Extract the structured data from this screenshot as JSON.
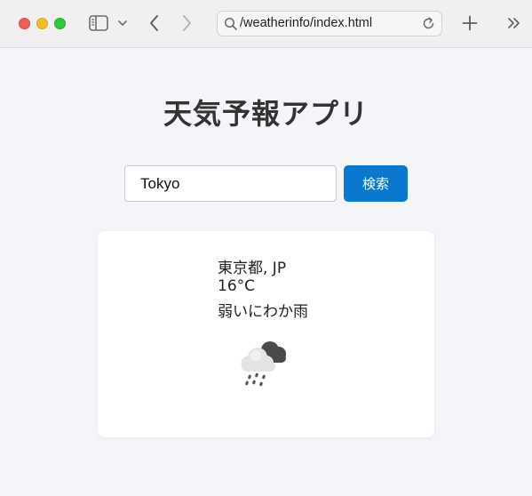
{
  "browser": {
    "url": "/weatherinfo/index.html"
  },
  "page": {
    "title": "天気予報アプリ"
  },
  "search": {
    "value": "Tokyo",
    "button_label": "検索"
  },
  "weather": {
    "location": "東京都, JP",
    "temperature": "16°C",
    "description": "弱いにわか雨",
    "icon": "cloud-rain-icon"
  },
  "colors": {
    "accent": "#0a78d1",
    "background": "#f3f5f9",
    "card": "#ffffff"
  }
}
